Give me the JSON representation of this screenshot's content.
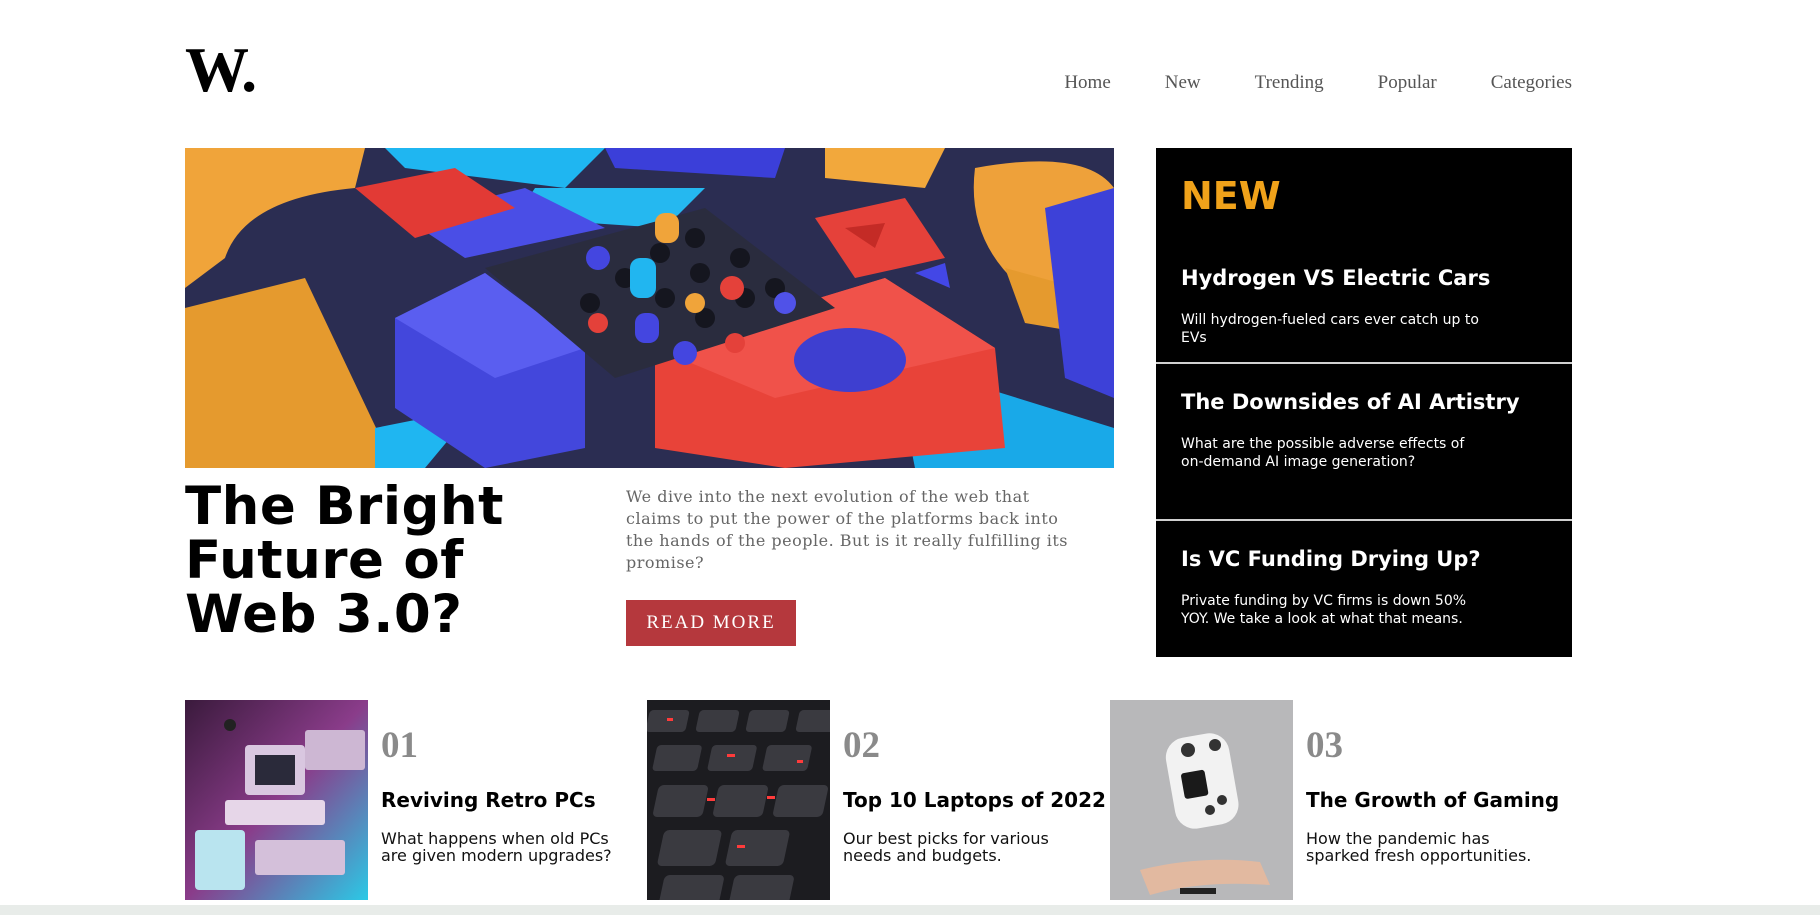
{
  "header": {
    "logo": "W.",
    "nav": [
      "Home",
      "New",
      "Trending",
      "Popular",
      "Categories"
    ]
  },
  "hero": {
    "title": "The Bright Future of Web 3.0?",
    "description": "We dive into the next evolution of the web that claims to put the power of the platforms back into the hands of the people. But is it really fulfilling its promise?",
    "button": "READ MORE"
  },
  "sidebar": {
    "heading": "NEW",
    "items": [
      {
        "title": "Hydrogen VS Electric Cars",
        "desc": "Will hydrogen-fueled cars ever catch up to EVs"
      },
      {
        "title": "The Downsides of AI Artistry",
        "desc": "What are the possible adverse effects of on-demand AI image generation?"
      },
      {
        "title": "Is VC Funding Drying Up?",
        "desc": "Private funding by VC firms is down 50% YOY. We take a look at what that means."
      }
    ]
  },
  "cards": [
    {
      "num": "01",
      "title": "Reviving Retro PCs",
      "desc": "What happens when old PCs are given modern upgrades?"
    },
    {
      "num": "02",
      "title": "Top 10 Laptops of 2022",
      "desc": "Our best picks for various needs and budgets."
    },
    {
      "num": "03",
      "title": "The Growth of Gaming",
      "desc": "How the pandemic has sparked fresh opportunities."
    }
  ],
  "colors": {
    "accent": "#f0a21a",
    "button": "#b5383d",
    "sidebar_bg": "#000000",
    "muted": "#8a8a8a"
  }
}
